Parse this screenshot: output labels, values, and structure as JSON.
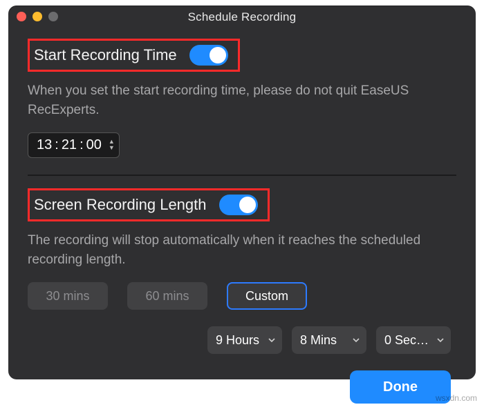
{
  "window": {
    "title": "Schedule Recording"
  },
  "start": {
    "label": "Start Recording Time",
    "toggle_on": true,
    "description": "When you set the start recording time, please do not quit EaseUS RecExperts.",
    "time": {
      "hh": "13",
      "mm": "21",
      "ss": "00"
    }
  },
  "length": {
    "label": "Screen Recording Length",
    "toggle_on": true,
    "description": "The recording will stop automatically when it reaches the scheduled recording length.",
    "presets": [
      "30 mins",
      "60 mins",
      "Custom"
    ],
    "selected_preset": "Custom",
    "custom": {
      "hours": "9 Hours",
      "mins": "8 Mins",
      "secs": "0 Sec…"
    }
  },
  "footer": {
    "done": "Done"
  },
  "watermark": "wsxdn.com"
}
